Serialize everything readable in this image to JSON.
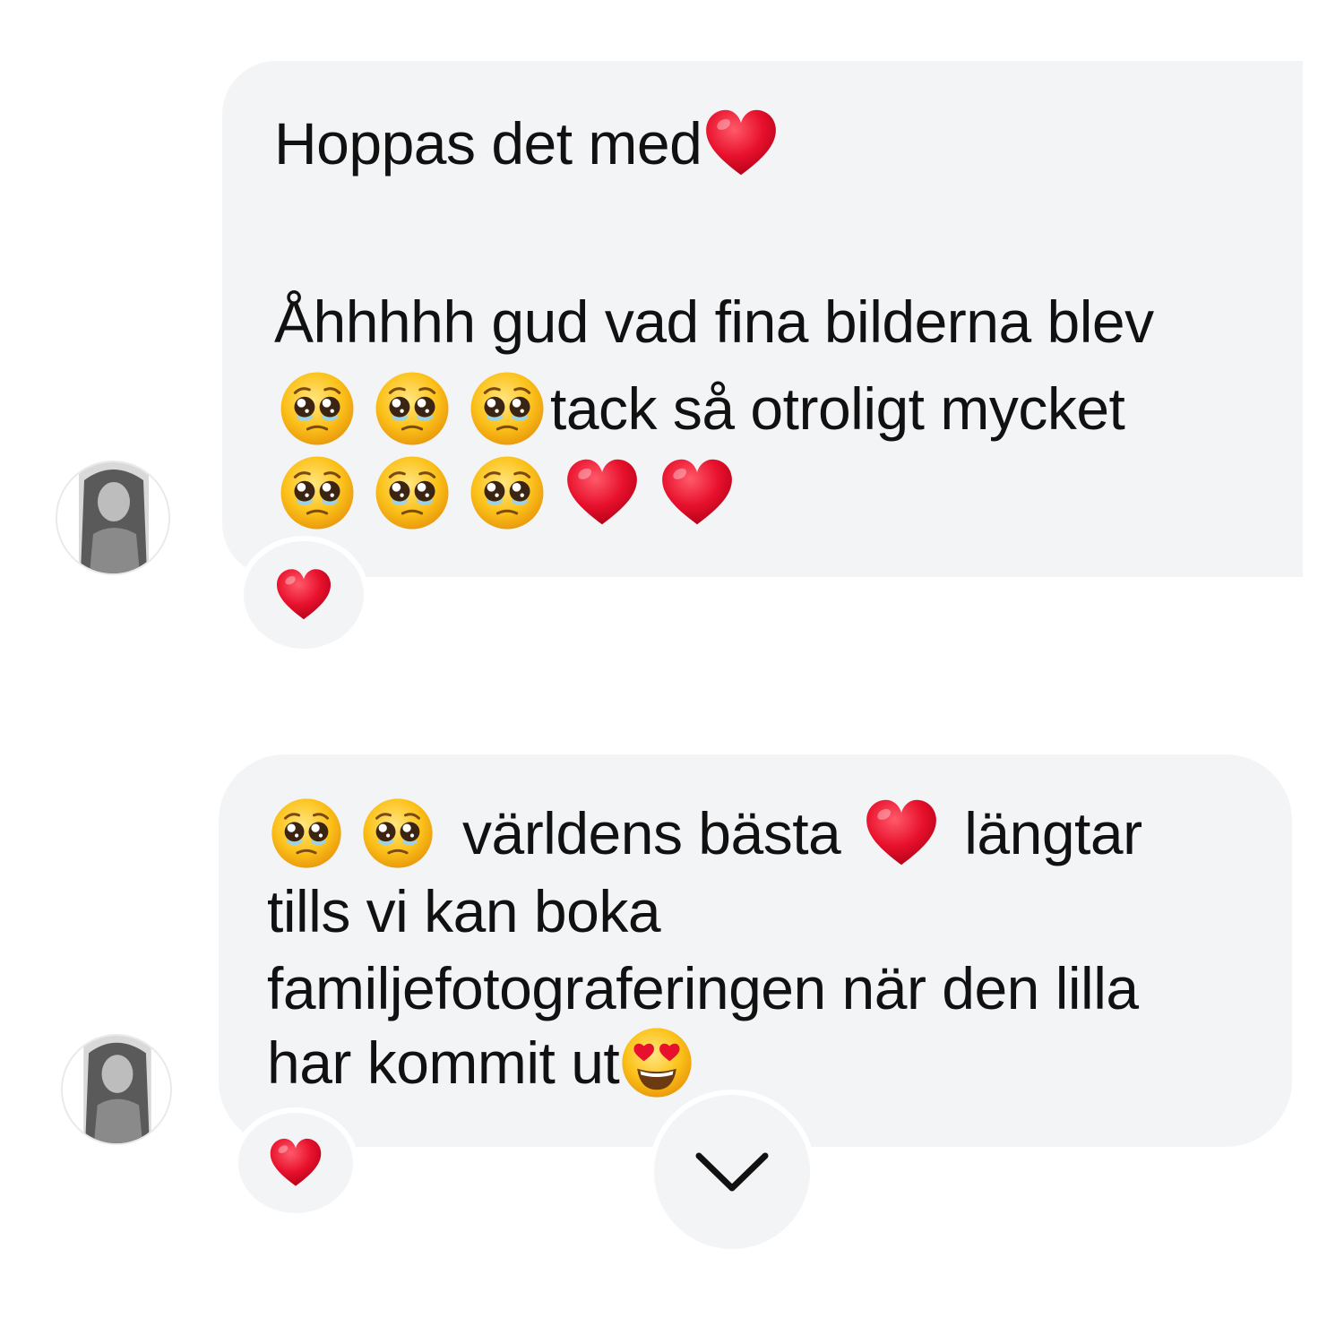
{
  "messages": [
    {
      "lines": [
        {
          "text": "Hoppas det med"
        },
        {
          "text": ""
        },
        {
          "text": "Åhhhhh gud vad fina bilderna blev"
        },
        {
          "text": "tack så otroligt mycket"
        },
        {
          "text": ""
        }
      ],
      "emojis": {
        "line1_end": "red-heart",
        "line4_start": [
          "pleading-face",
          "pleading-face",
          "pleading-face"
        ],
        "line5": [
          "pleading-face",
          "pleading-face",
          "pleading-face",
          "red-heart",
          "red-heart"
        ]
      },
      "reaction": "red-heart"
    },
    {
      "segments": {
        "l1_a": "världens bästa",
        "l1_b": "längtar",
        "l2": "tills vi kan boka",
        "l3": "familjefotograferingen när den lilla",
        "l4": "har kommit ut"
      },
      "emojis": {
        "line1_start": [
          "pleading-face",
          "pleading-face"
        ],
        "line1_mid": "red-heart",
        "line4_end": "smiling-face-with-heart-eyes"
      },
      "reaction": "red-heart"
    }
  ],
  "scroll_button_icon": "chevron-down-icon",
  "colors": {
    "bubble": "#f3f4f6",
    "text": "#111111",
    "heart": "#e8112d",
    "emoji_face": "#fcc21b"
  }
}
